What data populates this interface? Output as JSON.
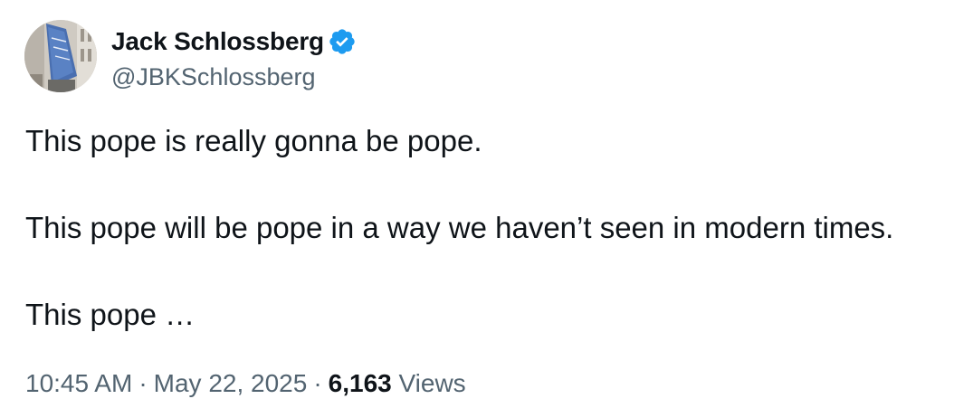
{
  "author": {
    "display_name": "Jack Schlossberg",
    "handle": "@JBKSchlossberg",
    "verified": true,
    "avatar_icon": "profile-photo-building-banner"
  },
  "tweet": {
    "lines": [
      "This pope is really gonna be pope.",
      "This pope will be pope in a way we haven’t seen in modern times.",
      "This pope …"
    ]
  },
  "meta": {
    "time": "10:45 AM",
    "separator": "·",
    "date": "May 22, 2025",
    "views_count": "6,163",
    "views_label": "Views"
  },
  "colors": {
    "text_primary": "#0f1419",
    "text_secondary": "#536471",
    "verified_blue": "#1d9bf0"
  }
}
